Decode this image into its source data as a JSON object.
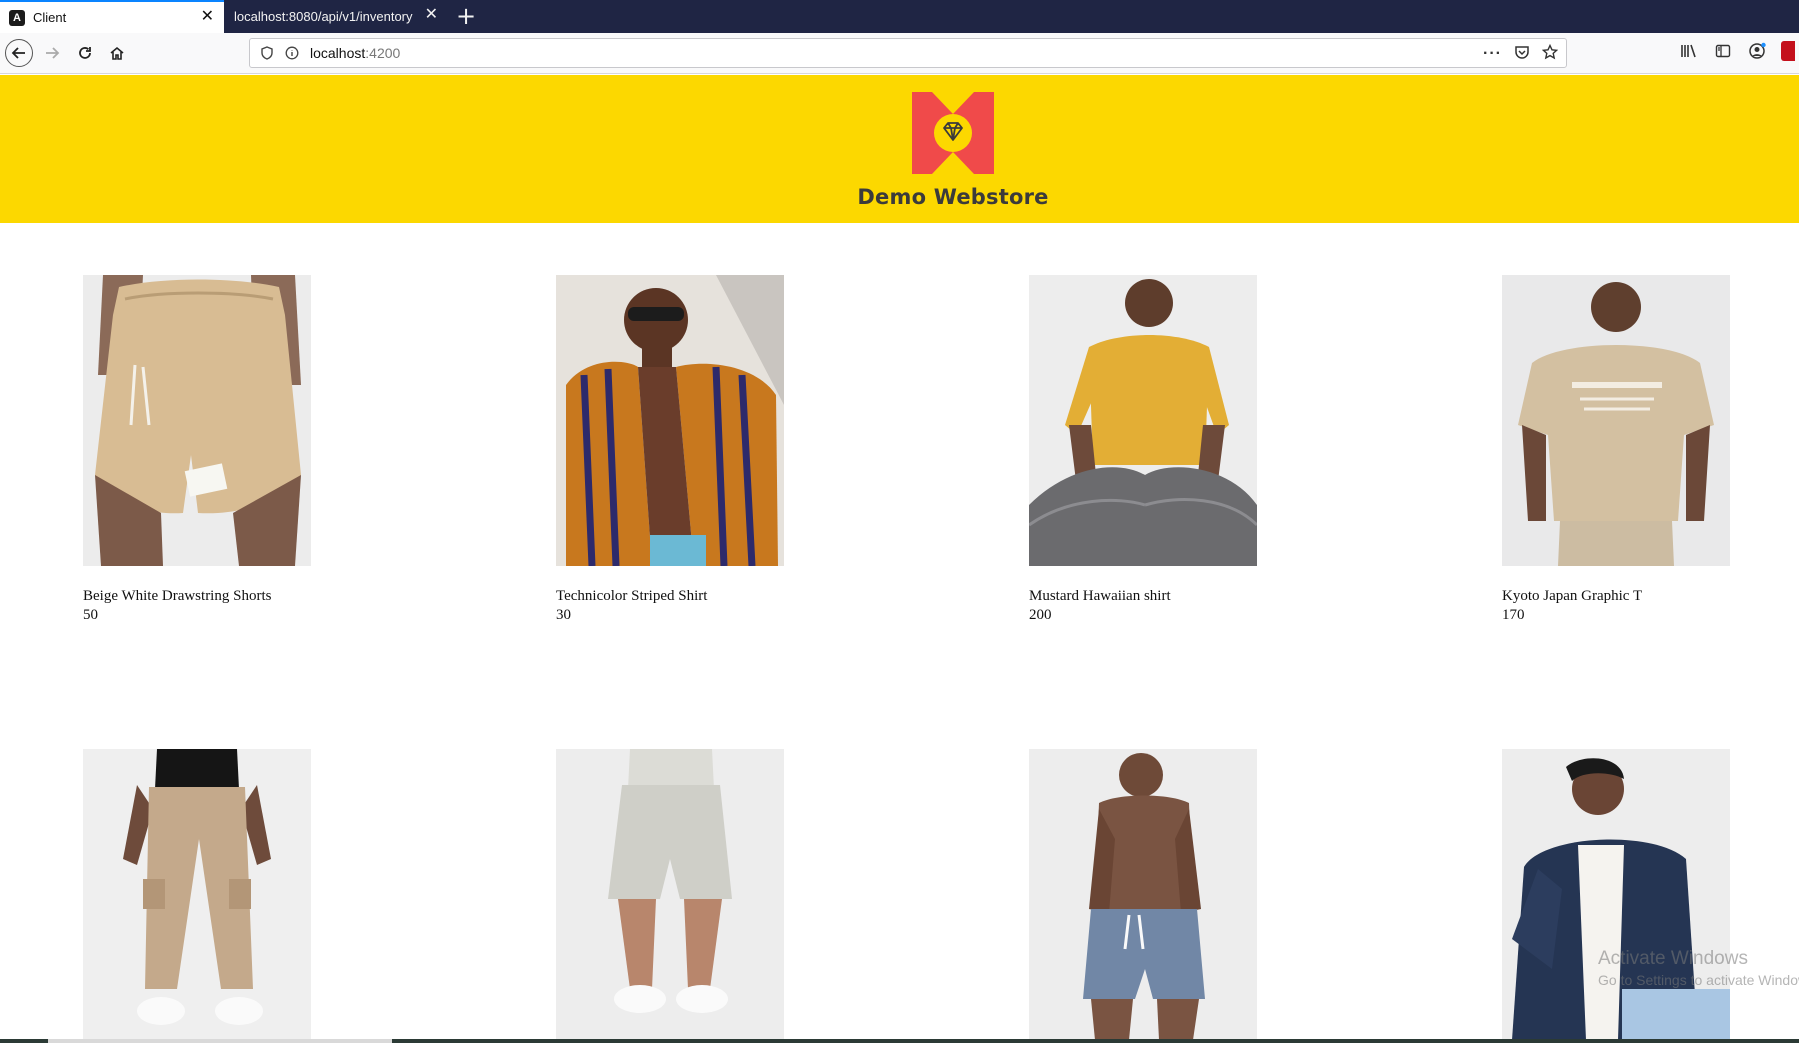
{
  "browser": {
    "tabs": [
      {
        "label": "Client",
        "active": true,
        "favicon": "angular-icon"
      },
      {
        "label": "localhost:8080/api/v1/inventory",
        "active": false
      }
    ],
    "url_host": "localhost",
    "url_port": ":4200"
  },
  "store": {
    "brand": "Demo Webstore",
    "logo_icon": "diamond-logo-icon",
    "header_color": "#fcd800",
    "logo_color": "#f04a4a"
  },
  "products": [
    {
      "name": "Beige White Drawstring Shorts",
      "qty": "50"
    },
    {
      "name": "Technicolor Striped Shirt",
      "qty": "30"
    },
    {
      "name": "Mustard Hawaiian shirt",
      "qty": "200"
    },
    {
      "name": "Kyoto Japan Graphic T",
      "qty": "170"
    },
    {
      "name": "",
      "qty": ""
    },
    {
      "name": "",
      "qty": ""
    },
    {
      "name": "",
      "qty": ""
    },
    {
      "name": "",
      "qty": ""
    }
  ],
  "os_watermark": {
    "line1": "Activate Windows",
    "line2": "Go to Settings to activate Windows."
  }
}
